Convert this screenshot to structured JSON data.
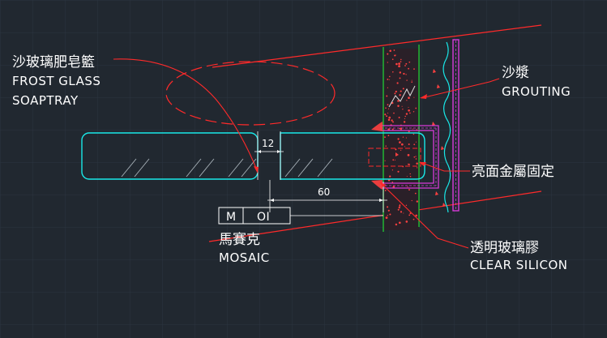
{
  "labels": {
    "soaptray_cn": "沙玻璃肥皂籃",
    "soaptray_en1": "FROST GLASS",
    "soaptray_en2": "SOAPTRAY",
    "grouting_cn": "沙漿",
    "grouting_en": "GROUTING",
    "metal_fix_cn": "亮面金屬固定",
    "silicon_cn": "透明玻璃膠",
    "silicon_en": "CLEAR SILICON",
    "mosaic_cn": "馬賽克",
    "mosaic_en": "MOSAIC",
    "tag_m": "M",
    "tag_code": "OI"
  },
  "dimensions": {
    "gap": "12",
    "length": "60"
  },
  "colors": {
    "background": "#212830",
    "leader": "#ff2a2a",
    "glass_outline": "#19e8e8",
    "wall_line": "#22cc33",
    "metal_bracket": "#d83ad8",
    "text": "#ffffff"
  }
}
